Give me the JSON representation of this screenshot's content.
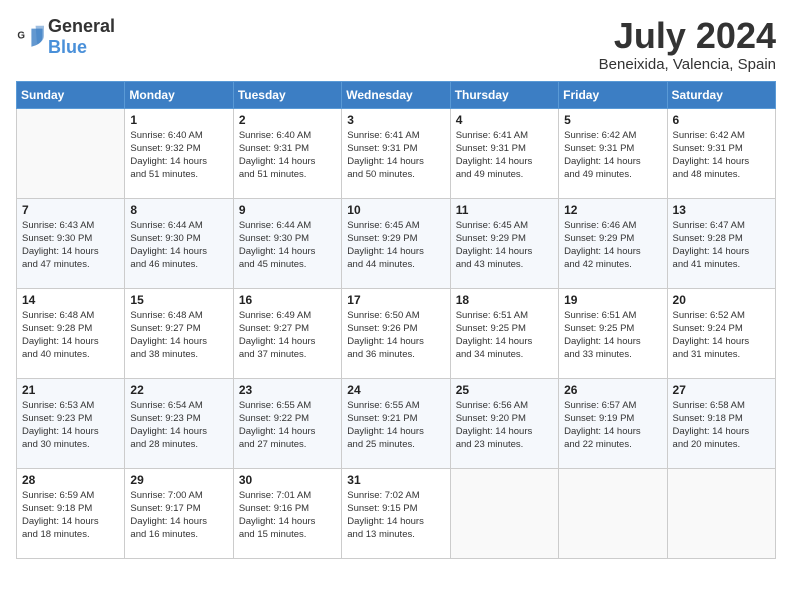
{
  "logo": {
    "general": "General",
    "blue": "Blue"
  },
  "title": "July 2024",
  "location": "Beneixida, Valencia, Spain",
  "days_of_week": [
    "Sunday",
    "Monday",
    "Tuesday",
    "Wednesday",
    "Thursday",
    "Friday",
    "Saturday"
  ],
  "weeks": [
    [
      null,
      {
        "day": "1",
        "sunrise": "6:40 AM",
        "sunset": "9:32 PM",
        "daylight": "14 hours and 51 minutes."
      },
      {
        "day": "2",
        "sunrise": "6:40 AM",
        "sunset": "9:31 PM",
        "daylight": "14 hours and 51 minutes."
      },
      {
        "day": "3",
        "sunrise": "6:41 AM",
        "sunset": "9:31 PM",
        "daylight": "14 hours and 50 minutes."
      },
      {
        "day": "4",
        "sunrise": "6:41 AM",
        "sunset": "9:31 PM",
        "daylight": "14 hours and 49 minutes."
      },
      {
        "day": "5",
        "sunrise": "6:42 AM",
        "sunset": "9:31 PM",
        "daylight": "14 hours and 49 minutes."
      },
      {
        "day": "6",
        "sunrise": "6:42 AM",
        "sunset": "9:31 PM",
        "daylight": "14 hours and 48 minutes."
      }
    ],
    [
      {
        "day": "7",
        "sunrise": "6:43 AM",
        "sunset": "9:30 PM",
        "daylight": "14 hours and 47 minutes."
      },
      {
        "day": "8",
        "sunrise": "6:44 AM",
        "sunset": "9:30 PM",
        "daylight": "14 hours and 46 minutes."
      },
      {
        "day": "9",
        "sunrise": "6:44 AM",
        "sunset": "9:30 PM",
        "daylight": "14 hours and 45 minutes."
      },
      {
        "day": "10",
        "sunrise": "6:45 AM",
        "sunset": "9:29 PM",
        "daylight": "14 hours and 44 minutes."
      },
      {
        "day": "11",
        "sunrise": "6:45 AM",
        "sunset": "9:29 PM",
        "daylight": "14 hours and 43 minutes."
      },
      {
        "day": "12",
        "sunrise": "6:46 AM",
        "sunset": "9:29 PM",
        "daylight": "14 hours and 42 minutes."
      },
      {
        "day": "13",
        "sunrise": "6:47 AM",
        "sunset": "9:28 PM",
        "daylight": "14 hours and 41 minutes."
      }
    ],
    [
      {
        "day": "14",
        "sunrise": "6:48 AM",
        "sunset": "9:28 PM",
        "daylight": "14 hours and 40 minutes."
      },
      {
        "day": "15",
        "sunrise": "6:48 AM",
        "sunset": "9:27 PM",
        "daylight": "14 hours and 38 minutes."
      },
      {
        "day": "16",
        "sunrise": "6:49 AM",
        "sunset": "9:27 PM",
        "daylight": "14 hours and 37 minutes."
      },
      {
        "day": "17",
        "sunrise": "6:50 AM",
        "sunset": "9:26 PM",
        "daylight": "14 hours and 36 minutes."
      },
      {
        "day": "18",
        "sunrise": "6:51 AM",
        "sunset": "9:25 PM",
        "daylight": "14 hours and 34 minutes."
      },
      {
        "day": "19",
        "sunrise": "6:51 AM",
        "sunset": "9:25 PM",
        "daylight": "14 hours and 33 minutes."
      },
      {
        "day": "20",
        "sunrise": "6:52 AM",
        "sunset": "9:24 PM",
        "daylight": "14 hours and 31 minutes."
      }
    ],
    [
      {
        "day": "21",
        "sunrise": "6:53 AM",
        "sunset": "9:23 PM",
        "daylight": "14 hours and 30 minutes."
      },
      {
        "day": "22",
        "sunrise": "6:54 AM",
        "sunset": "9:23 PM",
        "daylight": "14 hours and 28 minutes."
      },
      {
        "day": "23",
        "sunrise": "6:55 AM",
        "sunset": "9:22 PM",
        "daylight": "14 hours and 27 minutes."
      },
      {
        "day": "24",
        "sunrise": "6:55 AM",
        "sunset": "9:21 PM",
        "daylight": "14 hours and 25 minutes."
      },
      {
        "day": "25",
        "sunrise": "6:56 AM",
        "sunset": "9:20 PM",
        "daylight": "14 hours and 23 minutes."
      },
      {
        "day": "26",
        "sunrise": "6:57 AM",
        "sunset": "9:19 PM",
        "daylight": "14 hours and 22 minutes."
      },
      {
        "day": "27",
        "sunrise": "6:58 AM",
        "sunset": "9:18 PM",
        "daylight": "14 hours and 20 minutes."
      }
    ],
    [
      {
        "day": "28",
        "sunrise": "6:59 AM",
        "sunset": "9:18 PM",
        "daylight": "14 hours and 18 minutes."
      },
      {
        "day": "29",
        "sunrise": "7:00 AM",
        "sunset": "9:17 PM",
        "daylight": "14 hours and 16 minutes."
      },
      {
        "day": "30",
        "sunrise": "7:01 AM",
        "sunset": "9:16 PM",
        "daylight": "14 hours and 15 minutes."
      },
      {
        "day": "31",
        "sunrise": "7:02 AM",
        "sunset": "9:15 PM",
        "daylight": "14 hours and 13 minutes."
      },
      null,
      null,
      null
    ]
  ]
}
